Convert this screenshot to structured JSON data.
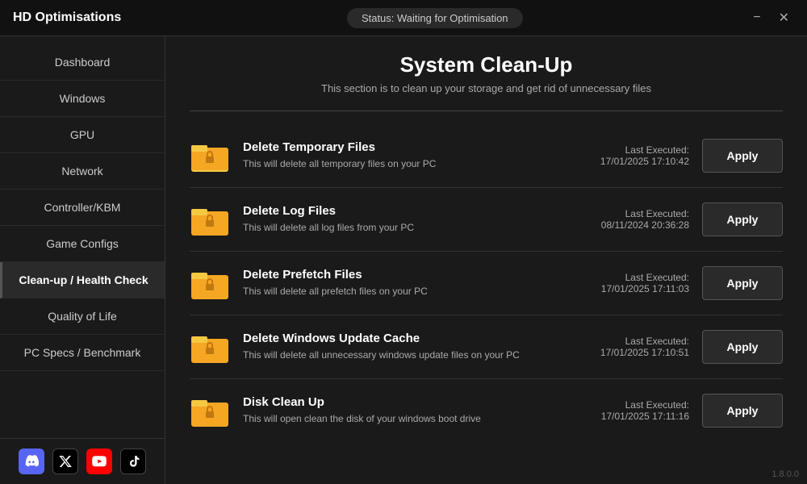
{
  "titleBar": {
    "appName": "HD Optimisations",
    "status": "Status: Waiting for Optimisation",
    "minimizeBtn": "−",
    "closeBtn": "✕"
  },
  "sidebar": {
    "items": [
      {
        "id": "dashboard",
        "label": "Dashboard",
        "active": false
      },
      {
        "id": "windows",
        "label": "Windows",
        "active": false
      },
      {
        "id": "gpu",
        "label": "GPU",
        "active": false
      },
      {
        "id": "network",
        "label": "Network",
        "active": false
      },
      {
        "id": "controller-kbm",
        "label": "Controller/KBM",
        "active": false
      },
      {
        "id": "game-configs",
        "label": "Game Configs",
        "active": false
      },
      {
        "id": "cleanup-health",
        "label": "Clean-up / Health Check",
        "active": true
      },
      {
        "id": "quality-of-life",
        "label": "Quality of Life",
        "active": false
      },
      {
        "id": "pc-specs",
        "label": "PC Specs / Benchmark",
        "active": false
      }
    ],
    "socials": [
      {
        "id": "discord",
        "label": "discord-icon",
        "symbol": "🎮"
      },
      {
        "id": "x",
        "label": "x-icon",
        "symbol": "✕"
      },
      {
        "id": "youtube",
        "label": "youtube-icon",
        "symbol": "▶"
      },
      {
        "id": "tiktok",
        "label": "tiktok-icon",
        "symbol": "♪"
      }
    ]
  },
  "main": {
    "title": "System Clean-Up",
    "subtitle": "This section is to clean up your storage and get rid of unnecessary files",
    "items": [
      {
        "id": "delete-temp-files",
        "title": "Delete Temporary Files",
        "desc": "This will delete all temporary files on your PC",
        "lastExecLabel": "Last Executed:",
        "lastExecValue": "17/01/2025 17:10:42",
        "applyLabel": "Apply"
      },
      {
        "id": "delete-log-files",
        "title": "Delete Log Files",
        "desc": "This will delete all log files from your PC",
        "lastExecLabel": "Last Executed:",
        "lastExecValue": "08/11/2024 20:36:28",
        "applyLabel": "Apply"
      },
      {
        "id": "delete-prefetch-files",
        "title": "Delete Prefetch Files",
        "desc": "This will delete all prefetch files on your PC",
        "lastExecLabel": "Last Executed:",
        "lastExecValue": "17/01/2025 17:11:03",
        "applyLabel": "Apply"
      },
      {
        "id": "delete-windows-update-cache",
        "title": "Delete Windows Update Cache",
        "desc": "This will delete all unnecessary windows update files on your PC",
        "lastExecLabel": "Last Executed:",
        "lastExecValue": "17/01/2025 17:10:51",
        "applyLabel": "Apply"
      },
      {
        "id": "disk-clean-up",
        "title": "Disk Clean Up",
        "desc": "This will open clean the disk of your windows boot drive",
        "lastExecLabel": "Last Executed:",
        "lastExecValue": "17/01/2025 17:11:16",
        "applyLabel": "Apply"
      }
    ]
  },
  "version": "1.8.0.0"
}
